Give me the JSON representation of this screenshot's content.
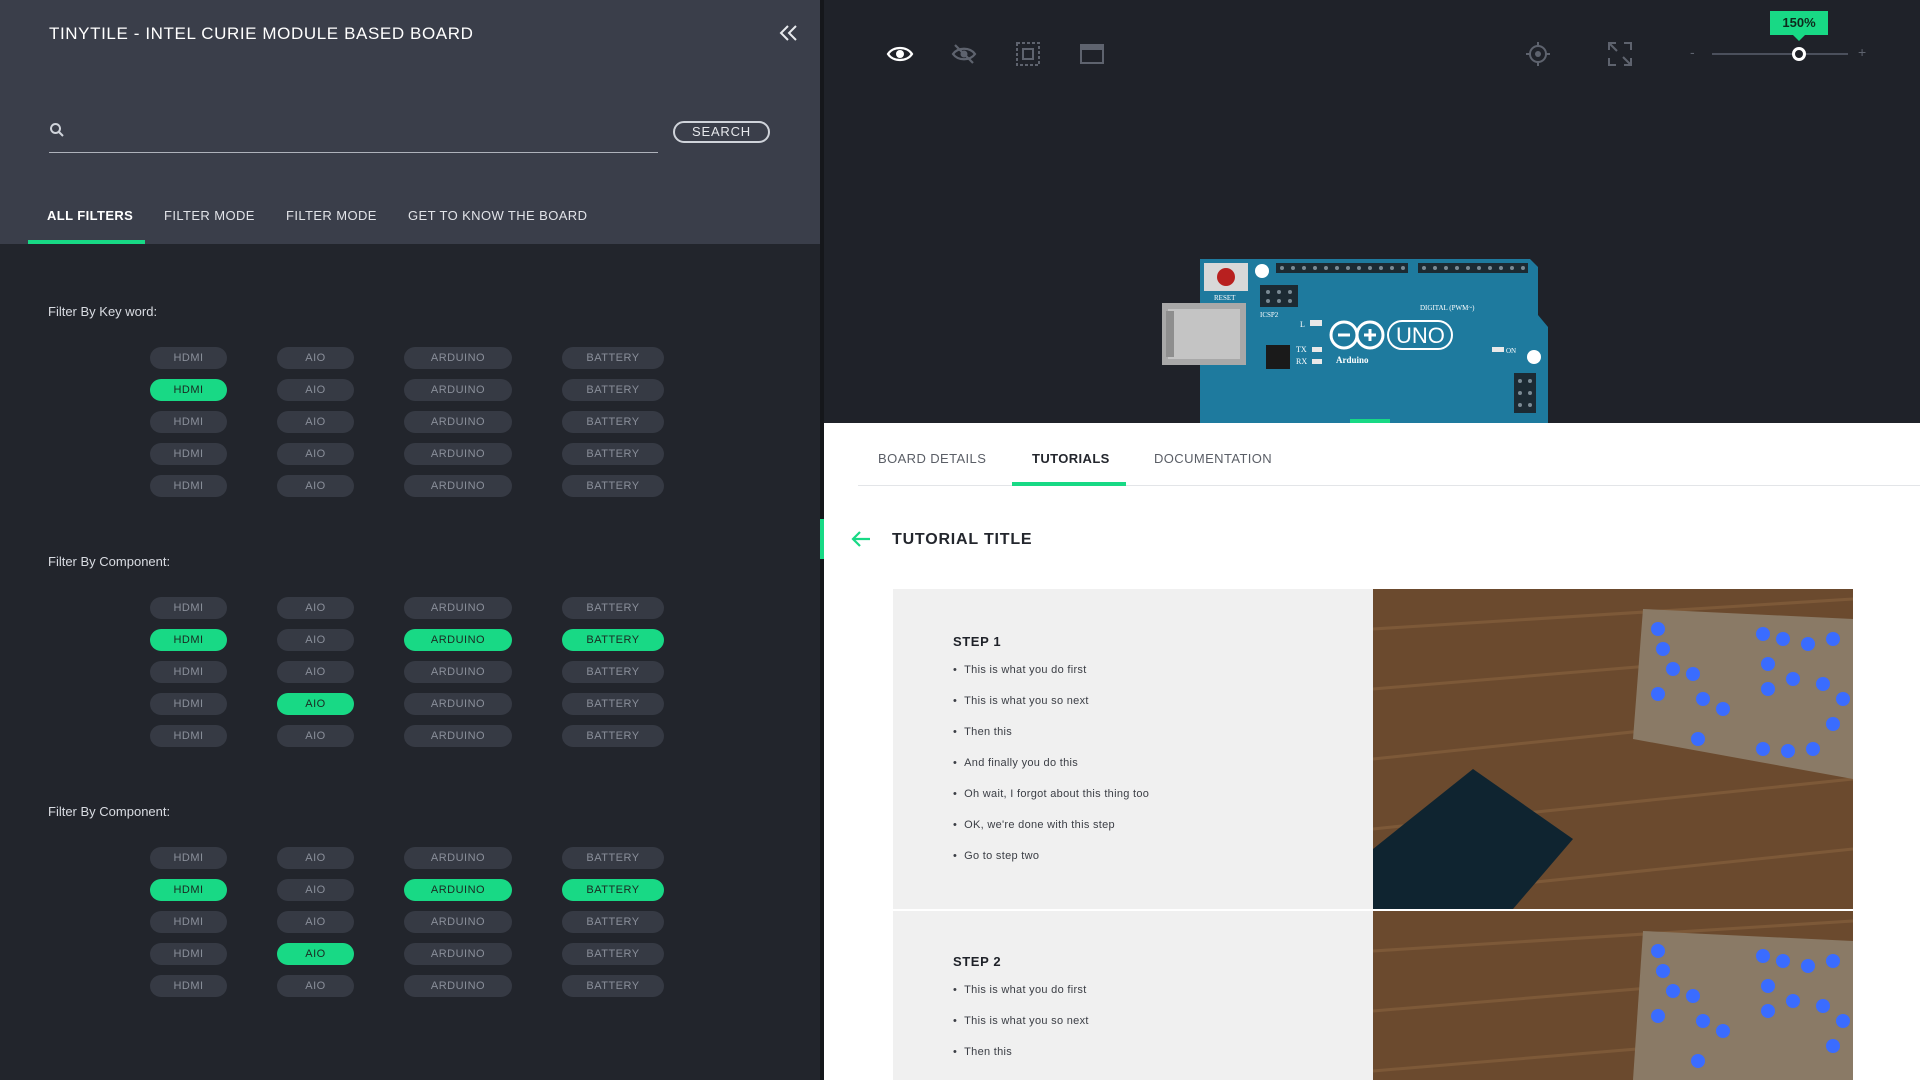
{
  "left_panel": {
    "title": "TINYTILE - INTEL CURIE MODULE BASED BOARD",
    "search": {
      "value": "",
      "placeholder": "",
      "button_label": "SEARCH"
    },
    "tabs": [
      {
        "label": "ALL FILTERS",
        "active": true
      },
      {
        "label": "FILTER MODE",
        "active": false
      },
      {
        "label": "FILTER MODE",
        "active": false
      },
      {
        "label": "GET TO KNOW THE BOARD",
        "active": false
      }
    ],
    "filter_sections": [
      {
        "label": "Filter By Key word:",
        "rows": [
          [
            {
              "label": "HDMI",
              "selected": false
            },
            {
              "label": "AIO",
              "selected": false
            },
            {
              "label": "ARDUINO",
              "selected": false
            },
            {
              "label": "BATTERY",
              "selected": false
            }
          ],
          [
            {
              "label": "HDMI",
              "selected": true
            },
            {
              "label": "AIO",
              "selected": false
            },
            {
              "label": "ARDUINO",
              "selected": false
            },
            {
              "label": "BATTERY",
              "selected": false
            }
          ],
          [
            {
              "label": "HDMI",
              "selected": false
            },
            {
              "label": "AIO",
              "selected": false
            },
            {
              "label": "ARDUINO",
              "selected": false
            },
            {
              "label": "BATTERY",
              "selected": false
            }
          ],
          [
            {
              "label": "HDMI",
              "selected": false
            },
            {
              "label": "AIO",
              "selected": false
            },
            {
              "label": "ARDUINO",
              "selected": false
            },
            {
              "label": "BATTERY",
              "selected": false
            }
          ],
          [
            {
              "label": "HDMI",
              "selected": false
            },
            {
              "label": "AIO",
              "selected": false
            },
            {
              "label": "ARDUINO",
              "selected": false
            },
            {
              "label": "BATTERY",
              "selected": false
            }
          ]
        ]
      },
      {
        "label": "Filter By Component:",
        "rows": [
          [
            {
              "label": "HDMI",
              "selected": false
            },
            {
              "label": "AIO",
              "selected": false
            },
            {
              "label": "ARDUINO",
              "selected": false
            },
            {
              "label": "BATTERY",
              "selected": false
            }
          ],
          [
            {
              "label": "HDMI",
              "selected": true
            },
            {
              "label": "AIO",
              "selected": false
            },
            {
              "label": "ARDUINO",
              "selected": true
            },
            {
              "label": "BATTERY",
              "selected": true
            }
          ],
          [
            {
              "label": "HDMI",
              "selected": false
            },
            {
              "label": "AIO",
              "selected": false
            },
            {
              "label": "ARDUINO",
              "selected": false
            },
            {
              "label": "BATTERY",
              "selected": false
            }
          ],
          [
            {
              "label": "HDMI",
              "selected": false
            },
            {
              "label": "AIO",
              "selected": true
            },
            {
              "label": "ARDUINO",
              "selected": false
            },
            {
              "label": "BATTERY",
              "selected": false
            }
          ],
          [
            {
              "label": "HDMI",
              "selected": false
            },
            {
              "label": "AIO",
              "selected": false
            },
            {
              "label": "ARDUINO",
              "selected": false
            },
            {
              "label": "BATTERY",
              "selected": false
            }
          ]
        ]
      },
      {
        "label": "Filter By Component:",
        "rows": [
          [
            {
              "label": "HDMI",
              "selected": false
            },
            {
              "label": "AIO",
              "selected": false
            },
            {
              "label": "ARDUINO",
              "selected": false
            },
            {
              "label": "BATTERY",
              "selected": false
            }
          ],
          [
            {
              "label": "HDMI",
              "selected": true
            },
            {
              "label": "AIO",
              "selected": false
            },
            {
              "label": "ARDUINO",
              "selected": true
            },
            {
              "label": "BATTERY",
              "selected": true
            }
          ],
          [
            {
              "label": "HDMI",
              "selected": false
            },
            {
              "label": "AIO",
              "selected": false
            },
            {
              "label": "ARDUINO",
              "selected": false
            },
            {
              "label": "BATTERY",
              "selected": false
            }
          ],
          [
            {
              "label": "HDMI",
              "selected": false
            },
            {
              "label": "AIO",
              "selected": true
            },
            {
              "label": "ARDUINO",
              "selected": false
            },
            {
              "label": "BATTERY",
              "selected": false
            }
          ],
          [
            {
              "label": "HDMI",
              "selected": false
            },
            {
              "label": "AIO",
              "selected": false
            },
            {
              "label": "ARDUINO",
              "selected": false
            },
            {
              "label": "BATTERY",
              "selected": false
            }
          ]
        ]
      }
    ]
  },
  "toolbar": {
    "icons": [
      "eye-icon",
      "eye-off-icon",
      "frame-select-icon",
      "window-icon"
    ],
    "right_icons": [
      "locate-icon",
      "fullscreen-icon"
    ],
    "zoom": {
      "label": "150%",
      "minus": "-",
      "plus": "+",
      "level": 0.64
    }
  },
  "board": {
    "labels": {
      "reset": "RESET",
      "icsp2": "ICSP2",
      "uno": "UNO",
      "arduino": "Arduino",
      "digital": "DIGITAL (PWM~)",
      "on": "ON",
      "tx": "TX",
      "rx": "RX",
      "l": "L"
    }
  },
  "details": {
    "tabs": [
      {
        "label": "BOARD DETAILS",
        "active": false
      },
      {
        "label": "TUTORIALS",
        "active": true
      },
      {
        "label": "DOCUMENTATION",
        "active": false
      }
    ],
    "tutorial_title": "TUTORIAL TITLE",
    "steps": [
      {
        "title": "STEP 1",
        "items": [
          "This is what you do first",
          "This is what you so next",
          "Then this",
          "And finally you do this",
          "Oh wait, I forgot about this thing too",
          "OK, we're done with this step",
          "Go to step two"
        ]
      },
      {
        "title": "STEP 2",
        "items": [
          "This is what you do first",
          "This is what you so next",
          "Then this"
        ]
      }
    ]
  },
  "colors": {
    "accent": "#18d985",
    "panel_dark": "#22252c",
    "panel_header": "#3a3e4a",
    "board_teal": "#1e7a9e"
  }
}
